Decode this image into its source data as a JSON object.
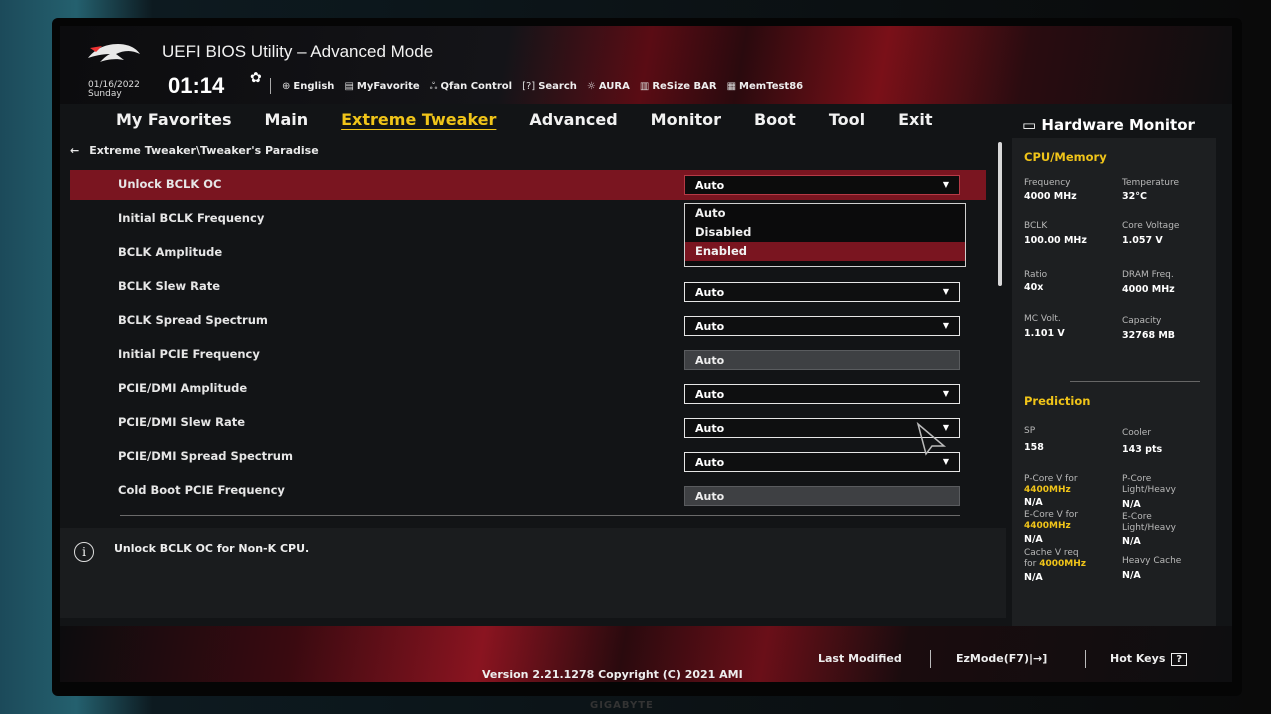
{
  "window": {
    "title": "UEFI BIOS Utility – Advanced Mode"
  },
  "status": {
    "date": "01/16/2022",
    "day": "Sunday",
    "time": "01:14"
  },
  "toolbar": [
    {
      "icon": "globe-icon",
      "label": "English"
    },
    {
      "icon": "favorite-icon",
      "label": "MyFavorite"
    },
    {
      "icon": "fan-icon",
      "label": "Qfan Control"
    },
    {
      "icon": "search-icon",
      "label": "Search"
    },
    {
      "icon": "aura-icon",
      "label": "AURA"
    },
    {
      "icon": "resize-bar-icon",
      "label": "ReSize BAR"
    },
    {
      "icon": "memtest-icon",
      "label": "MemTest86"
    }
  ],
  "tabs": [
    "My Favorites",
    "Main",
    "Extreme Tweaker",
    "Advanced",
    "Monitor",
    "Boot",
    "Tool",
    "Exit"
  ],
  "active_tab": "Extreme Tweaker",
  "breadcrumb": "Extreme Tweaker\\Tweaker's Paradise",
  "settings": [
    {
      "label": "Unlock BCLK OC",
      "value": "Auto",
      "state": "selected"
    },
    {
      "label": "Initial BCLK Frequency",
      "value": "",
      "state": "hidden"
    },
    {
      "label": "BCLK Amplitude",
      "value": "",
      "state": "hidden"
    },
    {
      "label": "BCLK Slew Rate",
      "value": "Auto",
      "state": "dropdown"
    },
    {
      "label": "BCLK Spread Spectrum",
      "value": "Auto",
      "state": "dropdown"
    },
    {
      "label": "Initial PCIE Frequency",
      "value": "Auto",
      "state": "disabled"
    },
    {
      "label": "PCIE/DMI Amplitude",
      "value": "Auto",
      "state": "dropdown"
    },
    {
      "label": "PCIE/DMI Slew Rate",
      "value": "Auto",
      "state": "dropdown"
    },
    {
      "label": "PCIE/DMI Spread Spectrum",
      "value": "Auto",
      "state": "dropdown"
    },
    {
      "label": "Cold Boot PCIE Frequency",
      "value": "Auto",
      "state": "disabled"
    }
  ],
  "dropdown_menu": {
    "options": [
      "Auto",
      "Disabled",
      "Enabled"
    ],
    "highlighted": "Enabled"
  },
  "help_text": "Unlock BCLK OC for Non-K CPU.",
  "hardware_monitor": {
    "title": "Hardware Monitor",
    "cpu_memory_title": "CPU/Memory",
    "cpu": [
      {
        "k": "Frequency",
        "v": "4000 MHz"
      },
      {
        "k": "Temperature",
        "v": "32°C"
      },
      {
        "k": "BCLK",
        "v": "100.00 MHz"
      },
      {
        "k": "Core Voltage",
        "v": "1.057 V"
      },
      {
        "k": "Ratio",
        "v": "40x"
      },
      {
        "k": "DRAM Freq.",
        "v": "4000 MHz"
      },
      {
        "k": "MC Volt.",
        "v": "1.101 V"
      },
      {
        "k": "Capacity",
        "v": "32768 MB"
      }
    ],
    "prediction_title": "Prediction",
    "sp": {
      "k": "SP",
      "v": "158"
    },
    "cooler": {
      "k": "Cooler",
      "v": "143 pts"
    },
    "pcore_v": {
      "k1": "P-Core V for",
      "k2": "4400MHz",
      "v": "N/A"
    },
    "pcore_lh": {
      "k1": "P-Core",
      "k2": "Light/Heavy",
      "v": "N/A"
    },
    "ecore_v": {
      "k1": "E-Core V for",
      "k2": "4400MHz",
      "v": "N/A"
    },
    "ecore_lh": {
      "k1": "E-Core",
      "k2": "Light/Heavy",
      "v": "N/A"
    },
    "cache_v": {
      "k1": "Cache V req",
      "k2a": "for ",
      "k2b": "4000MHz",
      "v": "N/A"
    },
    "heavy_cache": {
      "k": "Heavy Cache",
      "v": "N/A"
    }
  },
  "footer": {
    "version": "Version 2.21.1278 Copyright (C) 2021 AMI",
    "last_modified": "Last Modified",
    "ezmode": "EzMode(F7)|→]",
    "hot_keys": "Hot Keys",
    "hot_keys_key": "?"
  },
  "monitor_brand": "GIGABYTE",
  "colors": {
    "accent": "#f0c419",
    "selection": "#7a1520",
    "background": "#121416"
  }
}
